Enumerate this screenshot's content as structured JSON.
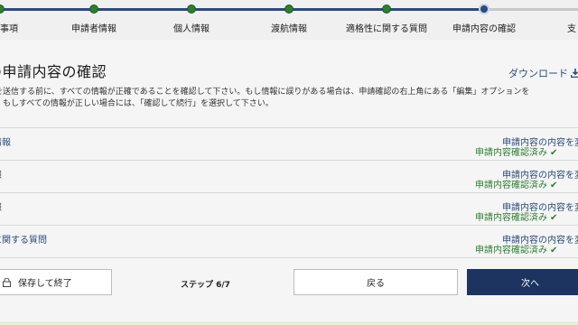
{
  "stepper": {
    "steps": [
      {
        "label": "事項",
        "state": "done"
      },
      {
        "label": "申請者情報",
        "state": "done"
      },
      {
        "label": "個人情報",
        "state": "done"
      },
      {
        "label": "渡航情報",
        "state": "done"
      },
      {
        "label": "適格性に関する質問",
        "state": "done"
      },
      {
        "label": "申請内容の確認",
        "state": "current"
      },
      {
        "label": "支",
        "state": "todo"
      }
    ]
  },
  "page": {
    "title": "の申請内容の確認",
    "download_label": "ダウンロード",
    "download_icon": "download-icon",
    "intro_line1": "を送信する前に、すべての情報が正確であることを確認して下さい。もし情報に誤りがある場合は、申請確認の右上角にある「編集」オプションを",
    "intro_line2": "。もしすべての情報が正しい場合には、「確認して続行」を選択して下さい。"
  },
  "sections": [
    {
      "label": "情報",
      "edit_label": "申請内容の内容を変",
      "status": "申請内容確認済み",
      "check": "✔"
    },
    {
      "label": "報",
      "edit_label": "申請内容の内容を変",
      "status": "申請内容確認済み",
      "check": "✔"
    },
    {
      "label": "報",
      "edit_label": "申請内容の内容を変",
      "status": "申請内容確認済み",
      "check": "✔"
    },
    {
      "label": "に関する質問",
      "edit_label": "申請内容の内容を変",
      "status": "申請内容確認済み",
      "check": "✔"
    }
  ],
  "footer": {
    "save_label": "保存して終了",
    "save_icon": "lock-icon",
    "step_counter": "ステップ 6/7",
    "back_label": "戻る",
    "next_label": "次へ"
  },
  "colors": {
    "primary": "#1d3461",
    "link": "#2c4a7a",
    "success": "#2e7d32",
    "background": "#f5f5f5"
  }
}
